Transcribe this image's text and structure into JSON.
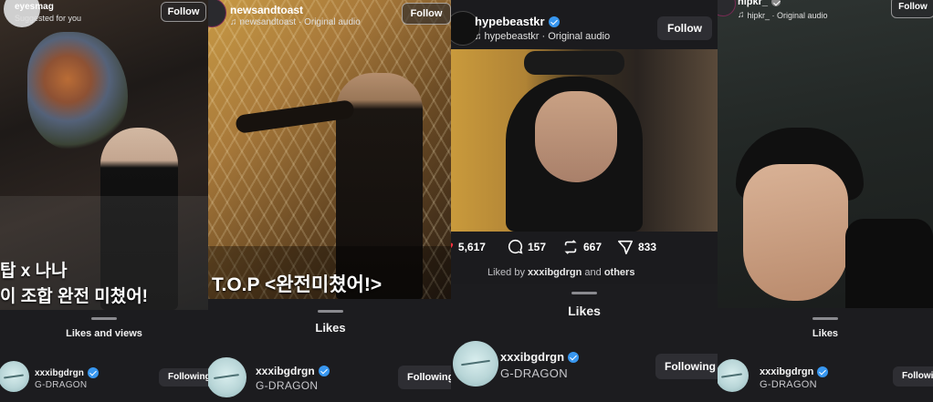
{
  "panel1": {
    "account": "eyesmag",
    "subtext": "Suggested for you",
    "follow_label": "Follow",
    "caption_line1": "탑 x 나나",
    "caption_line2": "이 조합 완전 미쳤어!",
    "sheet_title": "Likes and views",
    "liker": {
      "username": "xxxibgdrgn",
      "display_name": "G-DRAGON",
      "button": "Following"
    }
  },
  "panel2": {
    "account": "newsandtoast",
    "audio": "newsandtoast · Original audio",
    "follow_label": "Follow",
    "caption": "T.O.P <완전미쳤어!>",
    "sheet_title": "Likes",
    "liker": {
      "username": "xxxibgdrgn",
      "display_name": "G-DRAGON",
      "button": "Following"
    }
  },
  "panel3": {
    "account": "hypebeastkr",
    "audio": "hypebeastkr · Original audio",
    "follow_label": "Follow",
    "stats": {
      "likes": "5,617",
      "comments": "157",
      "reposts": "667",
      "shares": "833"
    },
    "liked_by_prefix": "Liked by",
    "liked_by_user": "xxxibgdrgn",
    "liked_by_mid": "and",
    "liked_by_others": "others",
    "sheet_title": "Likes",
    "liker": {
      "username": "xxxibgdrgn",
      "display_name": "G-DRAGON",
      "button": "Following"
    }
  },
  "panel4": {
    "account": "hipkr_",
    "audio": "hipkr_ · Original audio",
    "follow_label": "Follow",
    "sheet_title": "Likes",
    "liker": {
      "username": "xxxibgdrgn",
      "display_name": "G-DRAGON",
      "button": "Following"
    }
  },
  "colors": {
    "verified": "#3897f0",
    "sheet": "#1c1c1f",
    "like_red": "#ff3040"
  }
}
